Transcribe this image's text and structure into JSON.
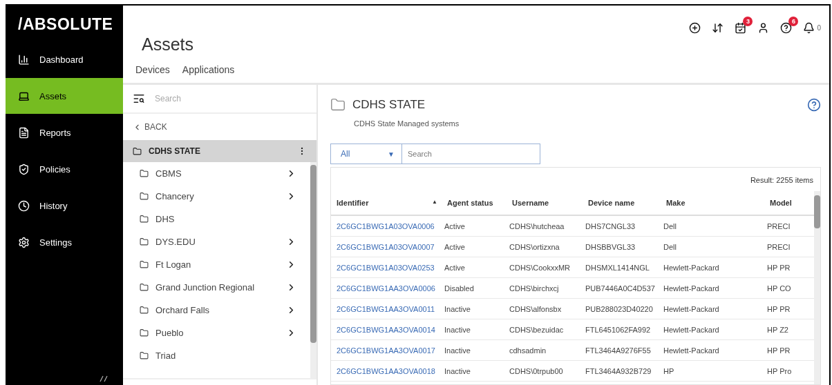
{
  "logo": "/ABSOLUTE",
  "nav": [
    {
      "label": "Dashboard",
      "selected": false
    },
    {
      "label": "Assets",
      "selected": true
    },
    {
      "label": "Reports",
      "selected": false
    },
    {
      "label": "Policies",
      "selected": false
    },
    {
      "label": "History",
      "selected": false
    },
    {
      "label": "Settings",
      "selected": false
    }
  ],
  "header": {
    "title": "Assets",
    "tabs": [
      {
        "label": "Devices"
      },
      {
        "label": "Applications"
      }
    ],
    "toolbar": {
      "calendar_badge": "3",
      "help_badge": "6",
      "notification_count": "0"
    }
  },
  "tree": {
    "search_placeholder": "Search",
    "back": "BACK",
    "root": {
      "label": "CDHS STATE",
      "selected": true
    },
    "children": [
      {
        "label": "CBMS",
        "has_children": true
      },
      {
        "label": "Chancery",
        "has_children": true
      },
      {
        "label": "DHS",
        "has_children": false
      },
      {
        "label": "DYS.EDU",
        "has_children": true
      },
      {
        "label": "Ft Logan",
        "has_children": true
      },
      {
        "label": "Grand Junction Regional",
        "has_children": true
      },
      {
        "label": "Orchard Falls",
        "has_children": true
      },
      {
        "label": "Pueblo",
        "has_children": true
      },
      {
        "label": "Triad",
        "has_children": false
      }
    ]
  },
  "detail": {
    "title": "CDHS STATE",
    "description": "CDHS State Managed systems",
    "filter": {
      "value": "All",
      "caret": "▼",
      "placeholder": "Search"
    },
    "result": "Result: 2255 items",
    "table": {
      "columns": [
        {
          "label": "Identifier",
          "sort": "▲"
        },
        {
          "label": "Agent status"
        },
        {
          "label": "Username"
        },
        {
          "label": "Device name"
        },
        {
          "label": "Make"
        },
        {
          "label": "Model"
        }
      ],
      "rows": [
        [
          "2C6GC1BWG1A03OVA0006",
          "Active",
          "CDHS\\hutcheaa",
          "DHS7CNGL33",
          "Dell",
          "PRECI"
        ],
        [
          "2C6GC1BWG1A03OVA0007",
          "Active",
          "CDHS\\ortizxna",
          "DHSBBVGL33",
          "Dell",
          "PRECI"
        ],
        [
          "2C6GC1BWG1A03OVA0253",
          "Active",
          "CDHS\\CookxxMR",
          "DHSMXL1414NGL",
          "Hewlett-Packard",
          "HP PR"
        ],
        [
          "2C6GC1BWG1AA3OVA0006",
          "Disabled",
          "CDHS\\birchxcj",
          "PUB7446A0C4D537",
          "Hewlett-Packard",
          "HP CO"
        ],
        [
          "2C6GC1BWG1AA3OVA0011",
          "Inactive",
          "CDHS\\alfonsbx",
          "PUB288023D40220",
          "Hewlett-Packard",
          "HP PR"
        ],
        [
          "2C6GC1BWG1AA3OVA0014",
          "Inactive",
          "CDHS\\bezuidac",
          "FTL6451062FA992",
          "Hewlett-Packard",
          "HP Z2"
        ],
        [
          "2C6GC1BWG1AA3OVA0017",
          "Inactive",
          "cdhsadmin",
          "FTL3464A9276F55",
          "Hewlett-Packard",
          "HP PR"
        ],
        [
          "2C6GC1BWG1AA3OVA0018",
          "Inactive",
          "CDHS\\0trpub00",
          "FTL3464A932B729",
          "HP",
          "HP Pro"
        ]
      ]
    }
  }
}
